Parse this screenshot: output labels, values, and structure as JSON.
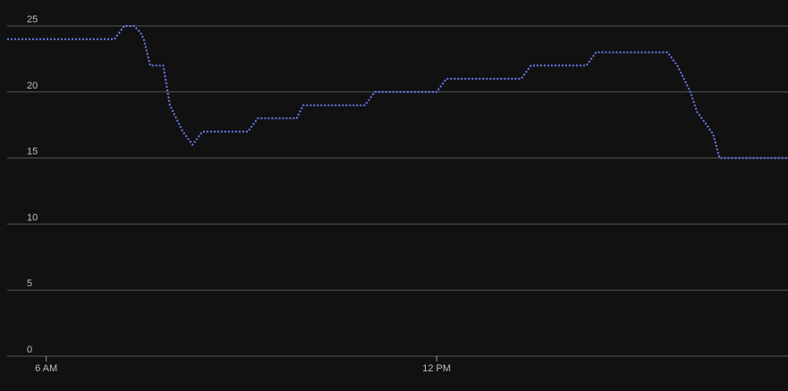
{
  "chart_data": {
    "type": "line",
    "title": "",
    "xlabel": "",
    "ylabel": "",
    "ylim": [
      0,
      25
    ],
    "y_ticks": [
      0,
      5,
      10,
      15,
      20,
      25
    ],
    "x_range_hours": [
      5.4,
      17.4
    ],
    "x_ticks": [
      {
        "label": "6 AM",
        "hour": 6.0
      },
      {
        "label": "12 PM",
        "hour": 12.0
      }
    ],
    "grid": "horizontal",
    "line_style": "dotted",
    "colors": {
      "background": "#111111",
      "grid": "#555555",
      "line": "#6b7cf0",
      "text": "#bdbdbd"
    },
    "series": [
      {
        "x": [
          5.4,
          7.05,
          7.2,
          7.35,
          7.45,
          7.5,
          7.6,
          7.8,
          7.9,
          8.1,
          8.25,
          8.4,
          8.55,
          9.1,
          9.25,
          9.85,
          9.95,
          10.9,
          11.05,
          12.0,
          12.15,
          13.3,
          13.45,
          14.3,
          14.45,
          15.2,
          15.35,
          15.55,
          15.7,
          15.9,
          16.0,
          16.15,
          16.25,
          16.35,
          17.4
        ],
        "values": [
          24,
          24,
          25,
          25,
          24.5,
          24,
          22,
          22,
          19,
          17,
          16,
          17,
          17,
          17,
          18,
          18,
          19,
          19,
          20,
          20,
          21,
          21,
          22,
          22,
          23,
          23,
          23,
          23,
          22,
          20,
          18.5,
          17.5,
          16.8,
          15,
          15
        ]
      }
    ]
  }
}
